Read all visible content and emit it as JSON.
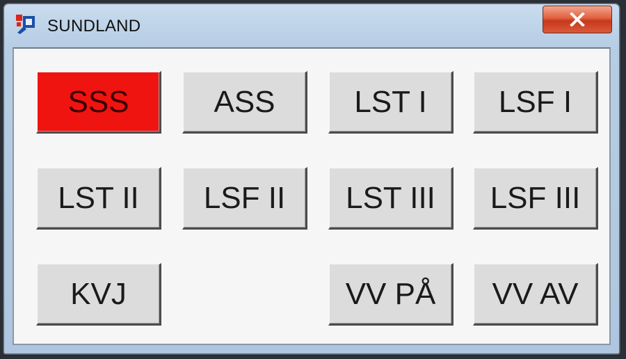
{
  "window": {
    "title": "SUNDLAND",
    "close_label": "x"
  },
  "buttons": {
    "sss": "SSS",
    "ass": "ASS",
    "lst_i": "LST I",
    "lsf_i": "LSF I",
    "lst_ii": "LST II",
    "lsf_ii": "LSF II",
    "lst_iii": "LST III",
    "lsf_iii": "LSF III",
    "kvj": "KVJ",
    "vv_pa": "VV PÅ",
    "vv_av": "VV AV"
  },
  "active_button": "SSS",
  "colors": {
    "active": "#f01410",
    "button": "#dcdcdc",
    "client_background": "#f6f6f6",
    "titlebar": "#b7cde4",
    "close_button": "#d95a3a"
  }
}
